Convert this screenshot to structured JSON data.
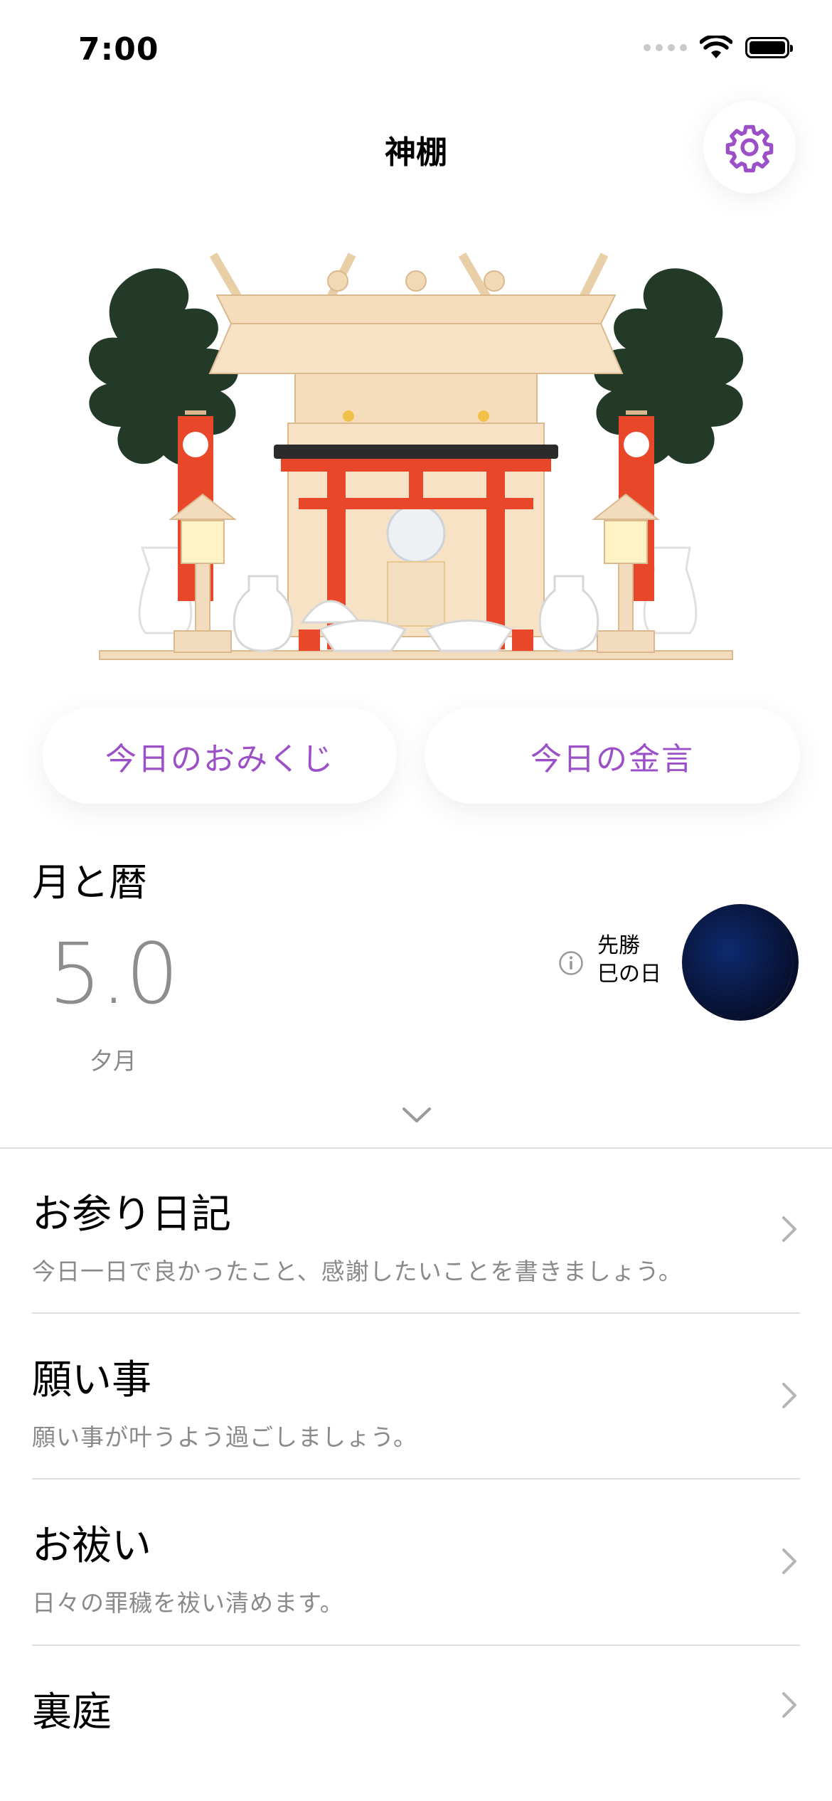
{
  "status_bar": {
    "time": "7:00"
  },
  "header": {
    "title": "神棚",
    "settings_icon": "gear-icon",
    "accent": "#9b50c8"
  },
  "buttons": {
    "omikuji": "今日のおみくじ",
    "kingen": "今日の金言"
  },
  "moon_section": {
    "title": "月と暦",
    "moon_age": "5.0",
    "moon_name": "夕月",
    "rokuyo": "先勝",
    "day_note": "巳の日"
  },
  "menu": [
    {
      "title": "お参り日記",
      "subtitle": "今日一日で良かったこと、感謝したいことを書きましょう。"
    },
    {
      "title": "願い事",
      "subtitle": "願い事が叶うよう過ごしましょう。"
    },
    {
      "title": "お祓い",
      "subtitle": "日々の罪穢を祓い清めます。"
    },
    {
      "title": "裏庭",
      "subtitle": ""
    }
  ]
}
